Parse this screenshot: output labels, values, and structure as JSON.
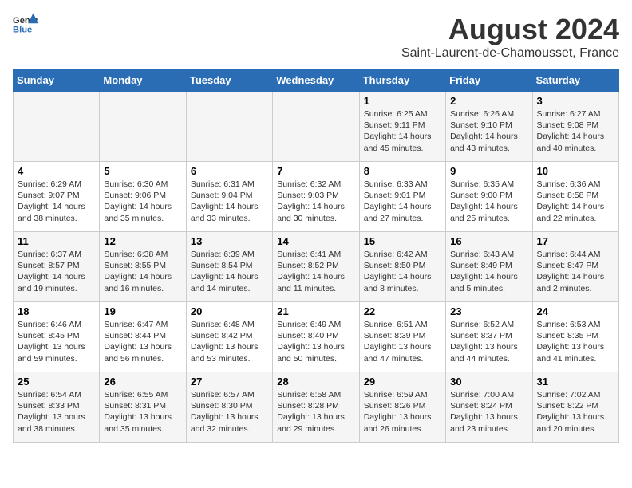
{
  "header": {
    "logo_general": "General",
    "logo_blue": "Blue",
    "month_title": "August 2024",
    "subtitle": "Saint-Laurent-de-Chamousset, France"
  },
  "weekdays": [
    "Sunday",
    "Monday",
    "Tuesday",
    "Wednesday",
    "Thursday",
    "Friday",
    "Saturday"
  ],
  "weeks": [
    [
      {
        "day": "",
        "info": ""
      },
      {
        "day": "",
        "info": ""
      },
      {
        "day": "",
        "info": ""
      },
      {
        "day": "",
        "info": ""
      },
      {
        "day": "1",
        "info": "Sunrise: 6:25 AM\nSunset: 9:11 PM\nDaylight: 14 hours\nand 45 minutes."
      },
      {
        "day": "2",
        "info": "Sunrise: 6:26 AM\nSunset: 9:10 PM\nDaylight: 14 hours\nand 43 minutes."
      },
      {
        "day": "3",
        "info": "Sunrise: 6:27 AM\nSunset: 9:08 PM\nDaylight: 14 hours\nand 40 minutes."
      }
    ],
    [
      {
        "day": "4",
        "info": "Sunrise: 6:29 AM\nSunset: 9:07 PM\nDaylight: 14 hours\nand 38 minutes."
      },
      {
        "day": "5",
        "info": "Sunrise: 6:30 AM\nSunset: 9:06 PM\nDaylight: 14 hours\nand 35 minutes."
      },
      {
        "day": "6",
        "info": "Sunrise: 6:31 AM\nSunset: 9:04 PM\nDaylight: 14 hours\nand 33 minutes."
      },
      {
        "day": "7",
        "info": "Sunrise: 6:32 AM\nSunset: 9:03 PM\nDaylight: 14 hours\nand 30 minutes."
      },
      {
        "day": "8",
        "info": "Sunrise: 6:33 AM\nSunset: 9:01 PM\nDaylight: 14 hours\nand 27 minutes."
      },
      {
        "day": "9",
        "info": "Sunrise: 6:35 AM\nSunset: 9:00 PM\nDaylight: 14 hours\nand 25 minutes."
      },
      {
        "day": "10",
        "info": "Sunrise: 6:36 AM\nSunset: 8:58 PM\nDaylight: 14 hours\nand 22 minutes."
      }
    ],
    [
      {
        "day": "11",
        "info": "Sunrise: 6:37 AM\nSunset: 8:57 PM\nDaylight: 14 hours\nand 19 minutes."
      },
      {
        "day": "12",
        "info": "Sunrise: 6:38 AM\nSunset: 8:55 PM\nDaylight: 14 hours\nand 16 minutes."
      },
      {
        "day": "13",
        "info": "Sunrise: 6:39 AM\nSunset: 8:54 PM\nDaylight: 14 hours\nand 14 minutes."
      },
      {
        "day": "14",
        "info": "Sunrise: 6:41 AM\nSunset: 8:52 PM\nDaylight: 14 hours\nand 11 minutes."
      },
      {
        "day": "15",
        "info": "Sunrise: 6:42 AM\nSunset: 8:50 PM\nDaylight: 14 hours\nand 8 minutes."
      },
      {
        "day": "16",
        "info": "Sunrise: 6:43 AM\nSunset: 8:49 PM\nDaylight: 14 hours\nand 5 minutes."
      },
      {
        "day": "17",
        "info": "Sunrise: 6:44 AM\nSunset: 8:47 PM\nDaylight: 14 hours\nand 2 minutes."
      }
    ],
    [
      {
        "day": "18",
        "info": "Sunrise: 6:46 AM\nSunset: 8:45 PM\nDaylight: 13 hours\nand 59 minutes."
      },
      {
        "day": "19",
        "info": "Sunrise: 6:47 AM\nSunset: 8:44 PM\nDaylight: 13 hours\nand 56 minutes."
      },
      {
        "day": "20",
        "info": "Sunrise: 6:48 AM\nSunset: 8:42 PM\nDaylight: 13 hours\nand 53 minutes."
      },
      {
        "day": "21",
        "info": "Sunrise: 6:49 AM\nSunset: 8:40 PM\nDaylight: 13 hours\nand 50 minutes."
      },
      {
        "day": "22",
        "info": "Sunrise: 6:51 AM\nSunset: 8:39 PM\nDaylight: 13 hours\nand 47 minutes."
      },
      {
        "day": "23",
        "info": "Sunrise: 6:52 AM\nSunset: 8:37 PM\nDaylight: 13 hours\nand 44 minutes."
      },
      {
        "day": "24",
        "info": "Sunrise: 6:53 AM\nSunset: 8:35 PM\nDaylight: 13 hours\nand 41 minutes."
      }
    ],
    [
      {
        "day": "25",
        "info": "Sunrise: 6:54 AM\nSunset: 8:33 PM\nDaylight: 13 hours\nand 38 minutes."
      },
      {
        "day": "26",
        "info": "Sunrise: 6:55 AM\nSunset: 8:31 PM\nDaylight: 13 hours\nand 35 minutes."
      },
      {
        "day": "27",
        "info": "Sunrise: 6:57 AM\nSunset: 8:30 PM\nDaylight: 13 hours\nand 32 minutes."
      },
      {
        "day": "28",
        "info": "Sunrise: 6:58 AM\nSunset: 8:28 PM\nDaylight: 13 hours\nand 29 minutes."
      },
      {
        "day": "29",
        "info": "Sunrise: 6:59 AM\nSunset: 8:26 PM\nDaylight: 13 hours\nand 26 minutes."
      },
      {
        "day": "30",
        "info": "Sunrise: 7:00 AM\nSunset: 8:24 PM\nDaylight: 13 hours\nand 23 minutes."
      },
      {
        "day": "31",
        "info": "Sunrise: 7:02 AM\nSunset: 8:22 PM\nDaylight: 13 hours\nand 20 minutes."
      }
    ]
  ]
}
